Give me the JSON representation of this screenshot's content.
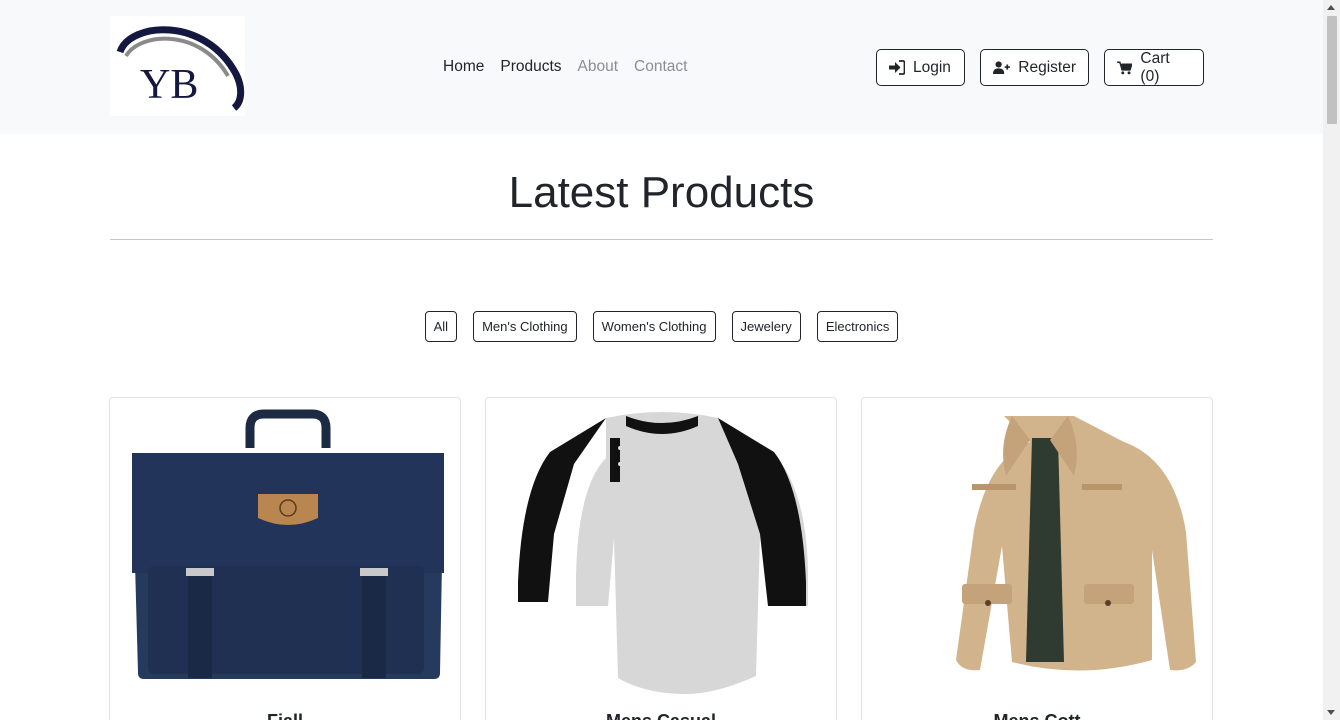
{
  "logo": {
    "text": "YB"
  },
  "nav": {
    "links": [
      {
        "label": "Home"
      },
      {
        "label": "Products"
      },
      {
        "label": "About"
      },
      {
        "label": "Contact"
      }
    ],
    "login_label": "Login",
    "register_label": "Register",
    "cart_label": "Cart (0)"
  },
  "section": {
    "title": "Latest Products"
  },
  "filters": [
    {
      "label": "All"
    },
    {
      "label": "Men's Clothing"
    },
    {
      "label": "Women's Clothing"
    },
    {
      "label": "Jewelery"
    },
    {
      "label": "Electronics"
    }
  ],
  "products": [
    {
      "title": "Fjall",
      "image": "navy-backpack"
    },
    {
      "title": "Mens Casual",
      "image": "raglan-henley-tshirt"
    },
    {
      "title": "Mens Cott",
      "image": "khaki-jacket"
    }
  ],
  "colors": {
    "navbar_bg": "#f8f9fa",
    "text": "#212529",
    "muted": "#8a8f94",
    "logo_navy": "#14173f"
  }
}
